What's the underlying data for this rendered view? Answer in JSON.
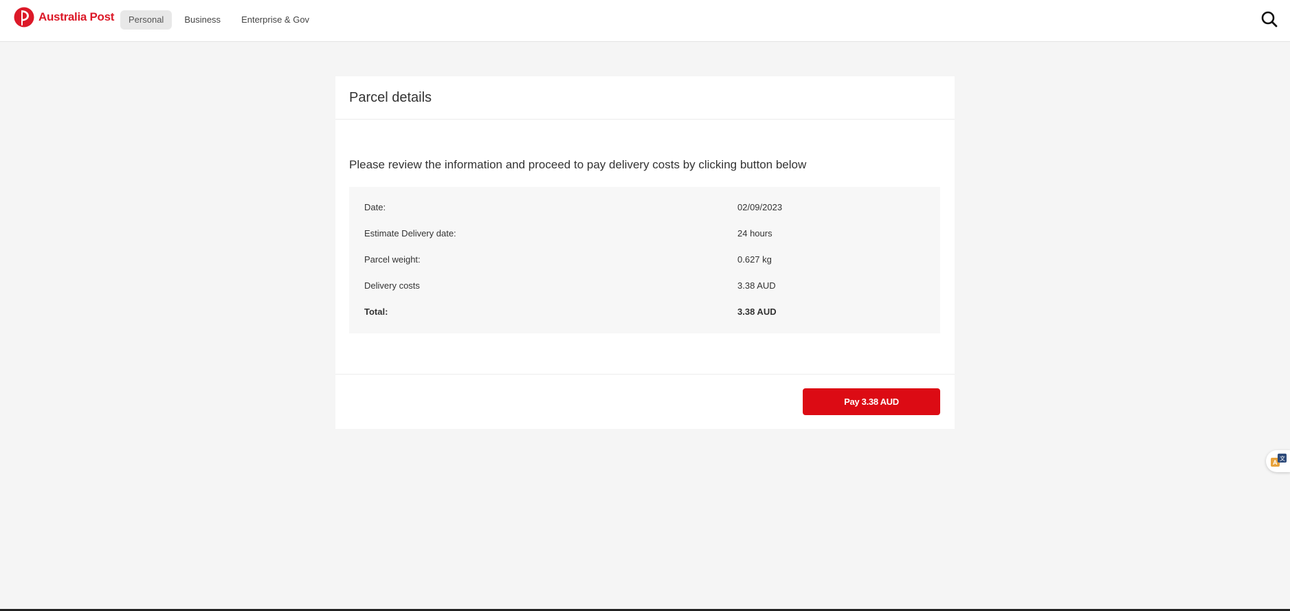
{
  "brand": {
    "name": "Australia Post",
    "color": "#dc1928"
  },
  "nav": {
    "items": [
      {
        "label": "Personal",
        "active": true
      },
      {
        "label": "Business",
        "active": false
      },
      {
        "label": "Enterprise & Gov",
        "active": false
      }
    ]
  },
  "header": {
    "search_icon": "search-icon"
  },
  "card": {
    "title": "Parcel details",
    "intro": "Please review the information and proceed to pay delivery costs by clicking button below",
    "details": [
      {
        "label": "Date:",
        "value": "02/09/2023"
      },
      {
        "label": "Estimate Delivery date:",
        "value": "24 hours"
      },
      {
        "label": "Parcel weight:",
        "value": "0.627 kg"
      },
      {
        "label": "Delivery costs",
        "value": "3.38 AUD"
      },
      {
        "label": "Total:",
        "value": "3.38 AUD"
      }
    ],
    "pay_button": "Pay 3.38 AUD",
    "pay_color": "#dc0b14"
  },
  "side_widget": {
    "icon": "translate-icon"
  }
}
